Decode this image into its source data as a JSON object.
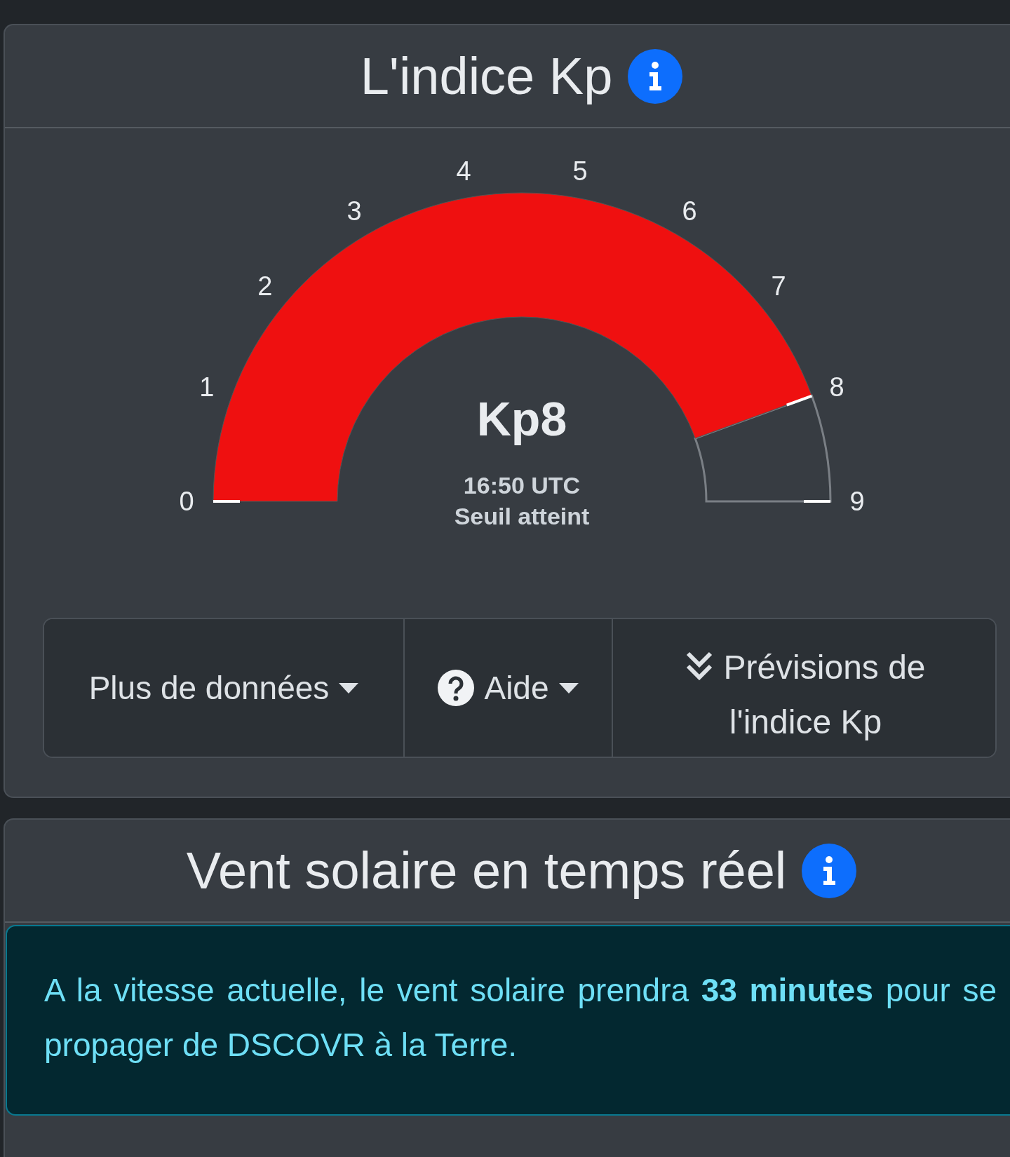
{
  "kp_card": {
    "title": "L'indice Kp",
    "gauge": {
      "ticks": [
        "0",
        "1",
        "2",
        "3",
        "4",
        "5",
        "6",
        "7",
        "8",
        "9"
      ],
      "value": "Kp8",
      "time": "16:50 UTC",
      "status": "Seuil atteint"
    },
    "buttons": [
      {
        "kind": "dropdown",
        "label": "Plus de données"
      },
      {
        "kind": "help",
        "label": "Aide"
      },
      {
        "kind": "forecast",
        "label": "Prévisions de l'indice Kp"
      }
    ]
  },
  "solar_wind_card": {
    "title": "Vent solaire en temps réel",
    "alert": "A la vitesse actuelle, le vent solaire prendra **33 minutes** pour se propager de DSCOVR à la Terre."
  }
}
